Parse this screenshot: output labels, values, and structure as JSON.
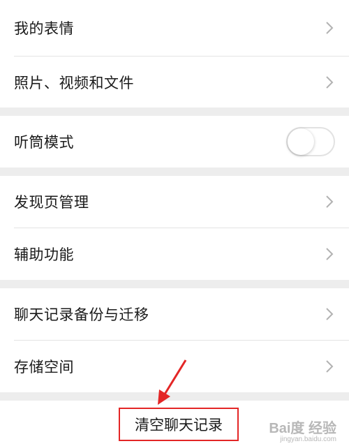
{
  "groups": [
    {
      "items": [
        {
          "label": "我的表情",
          "control": "chevron"
        },
        {
          "label": "照片、视频和文件",
          "control": "chevron"
        }
      ]
    },
    {
      "items": [
        {
          "label": "听筒模式",
          "control": "toggle",
          "toggle_on": false
        }
      ]
    },
    {
      "items": [
        {
          "label": "发现页管理",
          "control": "chevron"
        },
        {
          "label": "辅助功能",
          "control": "chevron"
        }
      ]
    },
    {
      "items": [
        {
          "label": "聊天记录备份与迁移",
          "control": "chevron"
        },
        {
          "label": "存储空间",
          "control": "chevron"
        }
      ]
    }
  ],
  "clear_button": {
    "label": "清空聊天记录"
  },
  "watermark": {
    "main": "Bai度 经验",
    "sub": "jingyan.baidu.com"
  },
  "colors": {
    "background": "#ededed",
    "row": "#ffffff",
    "annotation": "#e32626",
    "chevron": "#b2b2b2"
  },
  "icons": {
    "chevron": "chevron-right-icon",
    "arrow": "annotation-arrow-icon"
  }
}
